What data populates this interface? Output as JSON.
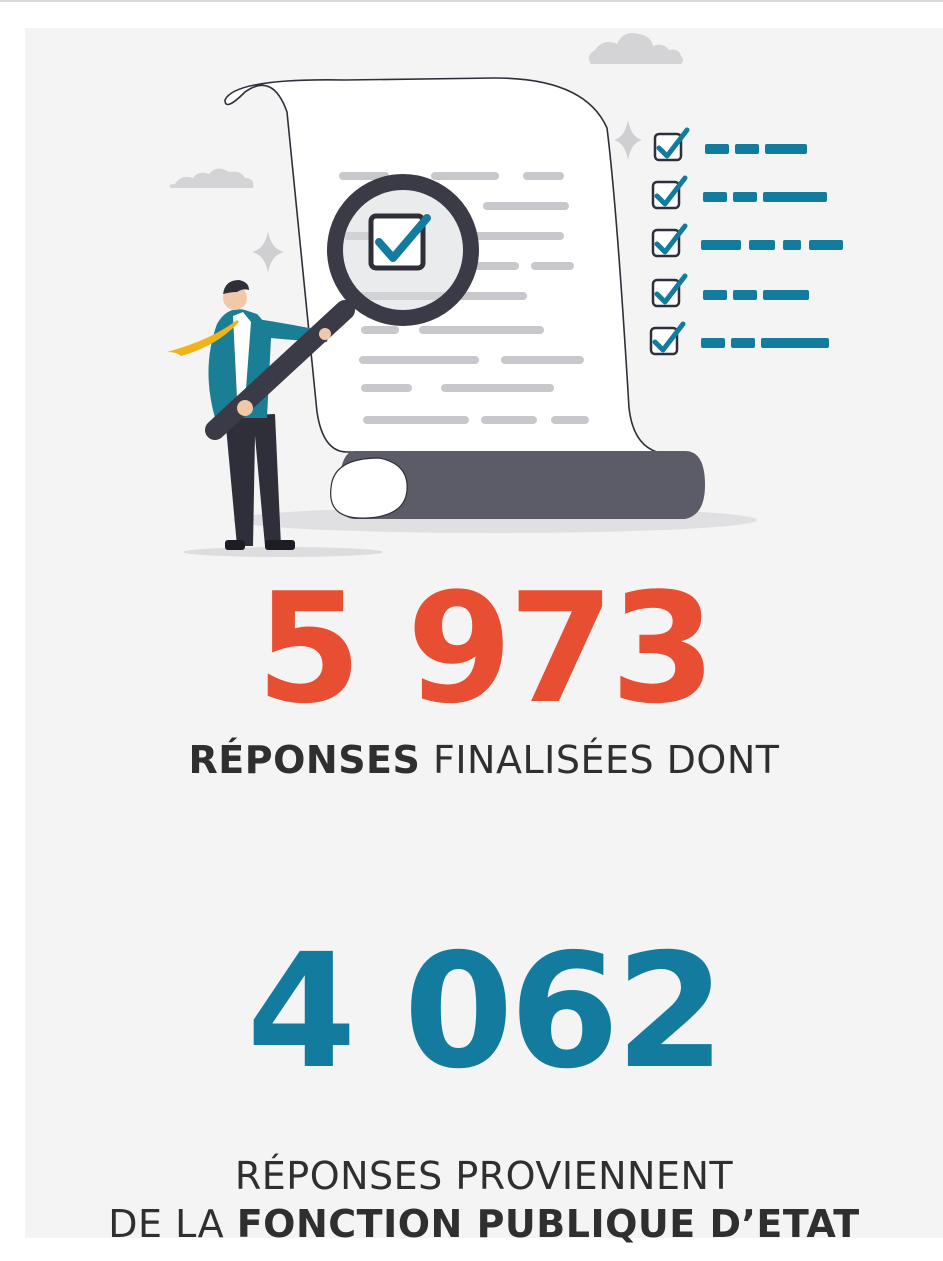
{
  "stats": [
    {
      "value": "5 973",
      "color": "#e84e31",
      "caption_bold": "RÉPONSES",
      "caption_rest": " FINALISÉES DONT"
    },
    {
      "value": "4 062",
      "color": "#137b9d",
      "caption_line1": "RÉPONSES PROVIENNENT",
      "caption_line2_regular": "DE LA ",
      "caption_line2_bold": "FONCTION PUBLIQUE D’ETAT"
    }
  ],
  "illustration": {
    "icons": [
      "document-scroll-icon",
      "magnifying-glass-icon",
      "checkbox-checked-icon",
      "person-icon",
      "cloud-icon",
      "sparkle-icon"
    ],
    "checklist_rows": 5,
    "colors": {
      "teal": "#137b9d",
      "dark": "#3b3b48",
      "grey_lines": "#c8c8cc",
      "paper": "#ffffff",
      "roll": "#5c5c68",
      "cloud": "#d4d4d6",
      "tie": "#f2b316",
      "shirt": "#1a7f95"
    }
  }
}
